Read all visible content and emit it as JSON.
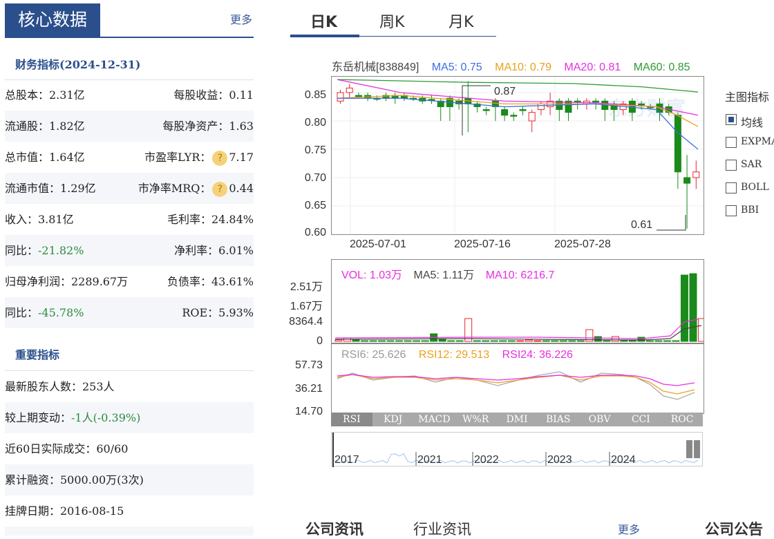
{
  "core": {
    "title": "核心数据",
    "more": "更多",
    "finance_title": "财务指标(2024-12-31)",
    "finance_rows": [
      {
        "left": "总股本：2.31亿",
        "right": "每股收益：0.11"
      },
      {
        "left": "流通股：1.82亿",
        "right": "每股净资产：1.63"
      },
      {
        "left": "总市值：1.64亿",
        "right_label": "市盈率LYR：",
        "right_value": "7.17"
      },
      {
        "left": "流通市值：1.29亿",
        "right_label": "市净率MRQ：",
        "right_value": "0.44"
      },
      {
        "left": "收入：3.81亿",
        "right": "毛利率：24.84%"
      },
      {
        "left_label": "同比：",
        "left_value": "-21.82%",
        "right": "净利率：6.01%"
      },
      {
        "left": "归母净利润：2289.67万",
        "right": "负债率：43.61%"
      },
      {
        "left_label": "同比：",
        "left_value": "-45.78%",
        "right": "ROE：5.93%"
      }
    ],
    "important_title": "重要指标",
    "important_rows": [
      {
        "text": "最新股东人数：253人"
      },
      {
        "label": "较上期变动：",
        "value": "-1人(-0.39%)"
      },
      {
        "text": "近60日实际成交：60/60"
      },
      {
        "text": "累计融资：5000.00万(3次)"
      },
      {
        "text": "挂牌日期：2016-08-15"
      }
    ],
    "help_icon": "question-icon"
  },
  "kline": {
    "tabs": [
      "日K",
      "周K",
      "月K"
    ],
    "active_tab": 0,
    "stock": "东岳机械[838849]",
    "ma": [
      {
        "label": "MA5: 0.75",
        "color": "#3b6fe0"
      },
      {
        "label": "MA10: 0.79",
        "color": "#e8a21c"
      },
      {
        "label": "MA20: 0.81",
        "color": "#e62ee0"
      },
      {
        "label": "MA60: 0.85",
        "color": "#2e9a33"
      }
    ],
    "price_ticks": [
      "0.85",
      "0.80",
      "0.75",
      "0.70",
      "0.65",
      "0.60"
    ],
    "date_ticks": [
      "2025-07-01",
      "2025-07-16",
      "2025-07-28"
    ],
    "high_mark": "0.87",
    "low_mark": "0.61",
    "watermark": "东方财富",
    "up_color": "#e8272b",
    "down_color": "#1a8a1a"
  },
  "main_indicator": {
    "title": "主图指标",
    "options": [
      "均线",
      "EXPMA",
      "SAR",
      "BOLL",
      "BBI"
    ],
    "checked": 0
  },
  "volume": {
    "vol_label": "VOL: 1.03万",
    "ma5_label": "MA5: 1.11万",
    "ma10_label": "MA10: 6216.7",
    "ticks": [
      "2.51万",
      "1.67万",
      "8364.4",
      "0"
    ]
  },
  "rsi": {
    "rsi6": "RSI6: 25.626",
    "rsi12": "RSI12: 29.513",
    "rsi24": "RSI24: 36.226",
    "ticks": [
      "57.73",
      "36.21",
      "14.70"
    ]
  },
  "indicator_tabs": [
    "RSI",
    "KDJ",
    "MACD",
    "W%R",
    "DMI",
    "BIAS",
    "OBV",
    "CCI",
    "ROC"
  ],
  "active_indicator": 0,
  "overview": {
    "years": [
      "2017",
      "2021",
      "2022",
      "2023",
      "2024"
    ]
  },
  "bottom": {
    "news": "公司资讯",
    "industry": "行业资讯",
    "more": "更多",
    "announce": "公司公告"
  }
}
